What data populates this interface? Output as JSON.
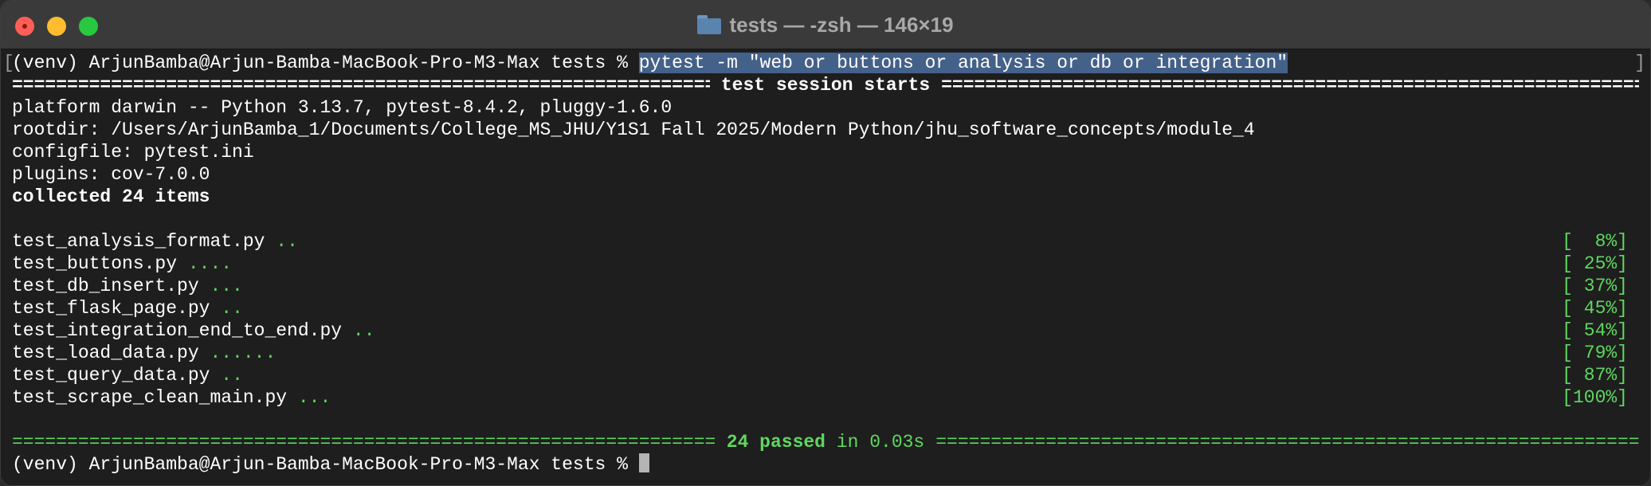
{
  "window": {
    "title": "tests — -zsh — 146×19",
    "folder_icon": "folder-icon"
  },
  "terminal": {
    "prompt": "(venv) ArjunBamba@Arjun-Bamba-MacBook-Pro-M3-Max tests % ",
    "command": "pytest -m \"web or buttons or analysis or db or integration\"",
    "session_header": "test session starts",
    "info": [
      "platform darwin -- Python 3.13.7, pytest-8.4.2, pluggy-1.6.0",
      "rootdir: /Users/ArjunBamba_1/Documents/College_MS_JHU/Y1S1 Fall 2025/Modern Python/jhu_software_concepts/module_4",
      "configfile: pytest.ini",
      "plugins: cov-7.0.0"
    ],
    "collected": "collected 24 items",
    "results": [
      {
        "file": "test_analysis_format.py",
        "dots": "..",
        "percent": "[  8%]"
      },
      {
        "file": "test_buttons.py",
        "dots": "....",
        "percent": "[ 25%]"
      },
      {
        "file": "test_db_insert.py",
        "dots": "...",
        "percent": "[ 37%]"
      },
      {
        "file": "test_flask_page.py",
        "dots": "..",
        "percent": "[ 45%]"
      },
      {
        "file": "test_integration_end_to_end.py",
        "dots": "..",
        "percent": "[ 54%]"
      },
      {
        "file": "test_load_data.py",
        "dots": "......",
        "percent": "[ 79%]"
      },
      {
        "file": "test_query_data.py",
        "dots": "..",
        "percent": "[ 87%]"
      },
      {
        "file": "test_scrape_clean_main.py",
        "dots": "...",
        "percent": "[100%]"
      }
    ],
    "summary": {
      "passed": "24 passed",
      "in_time": " in 0.03s"
    },
    "final_prompt": "(venv) ArjunBamba@Arjun-Bamba-MacBook-Pro-M3-Max tests % "
  },
  "colors": {
    "pass_green": "#5fd75f",
    "selection": "#44618a",
    "titlebar": "#3a3a3a",
    "background": "#1e1e1e"
  }
}
